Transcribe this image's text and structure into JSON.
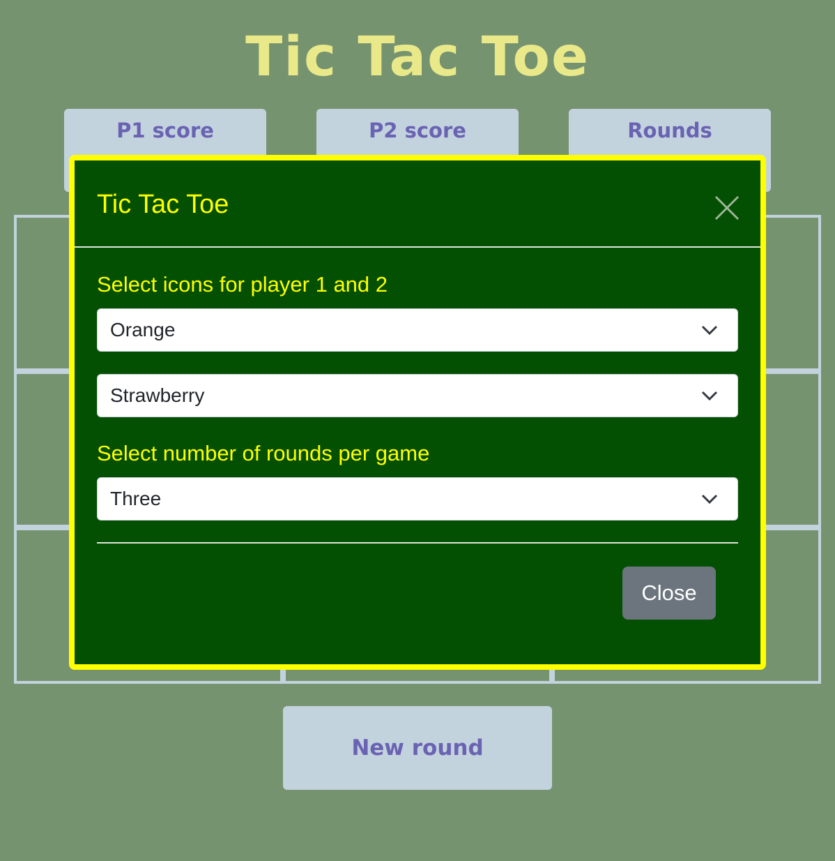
{
  "page": {
    "title": "Tic Tac Toe"
  },
  "scoreboard": {
    "p1_label": "P1 score",
    "p2_label": "P2 score",
    "rounds_label": "Rounds"
  },
  "board": {
    "rows": 3,
    "cols": 3
  },
  "controls": {
    "new_round_label": "New round"
  },
  "modal": {
    "title": "Tic Tac Toe",
    "close_icon": "close-icon",
    "icons_section_label": "Select icons for player 1 and 2",
    "player1_icon": {
      "selected": "Orange"
    },
    "player2_icon": {
      "selected": "Strawberry"
    },
    "rounds_section_label": "Select number of rounds per game",
    "rounds_select": {
      "selected": "Three"
    },
    "close_button_label": "Close"
  },
  "colors": {
    "page_background": "#769370",
    "title": "#e9e98a",
    "card_background": "#c2d3dd",
    "card_text": "#6a62b3",
    "modal_background": "#035002",
    "modal_border": "#ffff00",
    "modal_text": "#ffff00",
    "close_button": "#6c757d"
  }
}
